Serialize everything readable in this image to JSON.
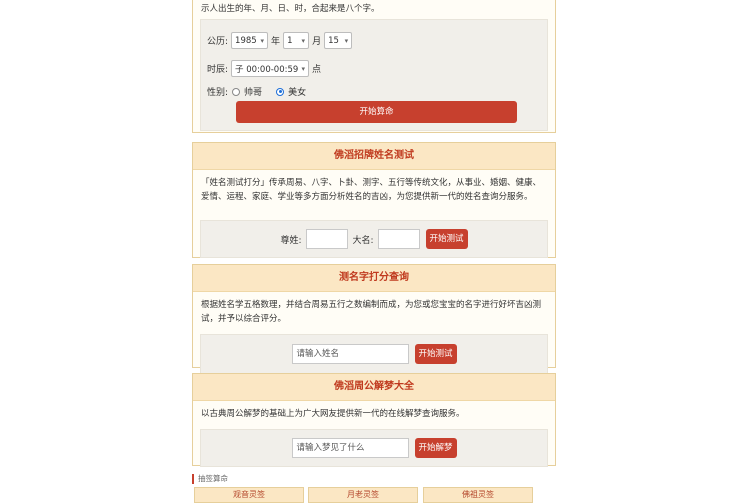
{
  "top": {
    "desc_tail": "示人出生的年、月、日、时，合起来是八个字。",
    "gongli_label": "公历:",
    "year": "1985",
    "year_unit": "年",
    "month": "1",
    "month_unit": "月",
    "day": "15",
    "time_label": "时辰:",
    "time": "子 00:00-00:59",
    "time_unit": "点",
    "gender_label": "性别:",
    "male": "帅哥",
    "female": "美女",
    "submit": "开始算命"
  },
  "name_test": {
    "title": "佛滔招牌姓名测试",
    "desc": "「姓名测试打分」传承周易、八字、卜卦、测字、五行等传统文化，从事业、婚姻、健康、爱情、运程、家庭、学业等多方面分析姓名的吉凶，为您提供新一代的姓名查询分服务。",
    "surname_label": "尊姓:",
    "given_label": "大名:",
    "button": "开始测试"
  },
  "name_score": {
    "title": "测名字打分查询",
    "desc": "根据姓名学五格数理，并结合周易五行之数编制而成，为您或您宝宝的名字进行好坏吉凶测试，并予以综合评分。",
    "placeholder": "请输入姓名",
    "button": "开始测试"
  },
  "dream": {
    "title": "佛滔周公解梦大全",
    "desc": "以古典周公解梦的基础上为广大网友提供新一代的在线解梦查询服务。",
    "placeholder": "请输入梦见了什么",
    "button": "开始解梦"
  },
  "footer": {
    "section_label": "抽签算命",
    "tabs": [
      "观音灵签",
      "月老灵签",
      "佛祖灵签"
    ]
  },
  "colors": {
    "accent": "#c7402e",
    "header_bg": "#fbe7c4",
    "border": "#e6cf9b"
  }
}
